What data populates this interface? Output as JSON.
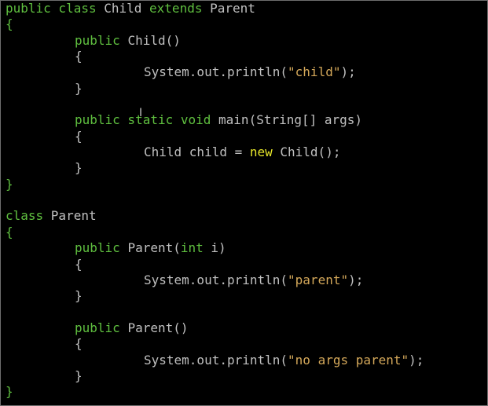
{
  "editor": {
    "lines": [
      {
        "indent": 0,
        "tokens": [
          {
            "t": "public class ",
            "c": "kw"
          },
          {
            "t": "Child ",
            "c": "id"
          },
          {
            "t": "extends ",
            "c": "kw"
          },
          {
            "t": "Parent",
            "c": "id"
          }
        ]
      },
      {
        "indent": 0,
        "tokens": [
          {
            "t": "{",
            "c": "brace"
          }
        ]
      },
      {
        "indent": 1,
        "tokens": [
          {
            "t": "public ",
            "c": "kw"
          },
          {
            "t": "Child()",
            "c": "id"
          }
        ]
      },
      {
        "indent": 1,
        "tokens": [
          {
            "t": "{",
            "c": "id"
          }
        ]
      },
      {
        "indent": 2,
        "tokens": [
          {
            "t": "System.out.println(",
            "c": "id"
          },
          {
            "t": "\"child\"",
            "c": "str"
          },
          {
            "t": ");",
            "c": "id"
          }
        ]
      },
      {
        "indent": 1,
        "tokens": [
          {
            "t": "}",
            "c": "id"
          }
        ]
      },
      {
        "indent": 0,
        "tokens": []
      },
      {
        "indent": 1,
        "tokens": [
          {
            "t": "public static void ",
            "c": "kw"
          },
          {
            "t": "main(String[] args)",
            "c": "id"
          }
        ]
      },
      {
        "indent": 1,
        "tokens": [
          {
            "t": "{",
            "c": "id"
          }
        ]
      },
      {
        "indent": 2,
        "tokens": [
          {
            "t": "Child child = ",
            "c": "id"
          },
          {
            "t": "new ",
            "c": "nw"
          },
          {
            "t": "Child();",
            "c": "id"
          }
        ]
      },
      {
        "indent": 1,
        "tokens": [
          {
            "t": "}",
            "c": "id"
          }
        ]
      },
      {
        "indent": 0,
        "tokens": [
          {
            "t": "}",
            "c": "brace"
          }
        ]
      },
      {
        "indent": 0,
        "tokens": []
      },
      {
        "indent": 0,
        "tokens": [
          {
            "t": "class ",
            "c": "kw"
          },
          {
            "t": "Parent",
            "c": "id"
          }
        ]
      },
      {
        "indent": 0,
        "tokens": [
          {
            "t": "{",
            "c": "brace"
          }
        ]
      },
      {
        "indent": 1,
        "tokens": [
          {
            "t": "public ",
            "c": "kw"
          },
          {
            "t": "Parent(",
            "c": "id"
          },
          {
            "t": "int ",
            "c": "kw"
          },
          {
            "t": "i)",
            "c": "id"
          }
        ]
      },
      {
        "indent": 1,
        "tokens": [
          {
            "t": "{",
            "c": "id"
          }
        ]
      },
      {
        "indent": 2,
        "tokens": [
          {
            "t": "System.out.println(",
            "c": "id"
          },
          {
            "t": "\"parent\"",
            "c": "str"
          },
          {
            "t": ");",
            "c": "id"
          }
        ]
      },
      {
        "indent": 1,
        "tokens": [
          {
            "t": "}",
            "c": "id"
          }
        ]
      },
      {
        "indent": 0,
        "tokens": []
      },
      {
        "indent": 1,
        "tokens": [
          {
            "t": "public ",
            "c": "kw"
          },
          {
            "t": "Parent()",
            "c": "id"
          }
        ]
      },
      {
        "indent": 1,
        "tokens": [
          {
            "t": "{",
            "c": "id"
          }
        ]
      },
      {
        "indent": 2,
        "tokens": [
          {
            "t": "System.out.println(",
            "c": "id"
          },
          {
            "t": "\"no args parent\"",
            "c": "str"
          },
          {
            "t": ");",
            "c": "id"
          }
        ]
      },
      {
        "indent": 1,
        "tokens": [
          {
            "t": "}",
            "c": "id"
          }
        ]
      },
      {
        "indent": 0,
        "tokens": [
          {
            "t": "}",
            "c": "brace"
          }
        ]
      }
    ]
  },
  "colors": {
    "background": "#000000",
    "keyword": "#5fbf3f",
    "new_keyword": "#e8e82a",
    "string": "#d4a85a",
    "text": "#c0c0c0"
  },
  "cursor": {
    "icon": "text-cursor-icon",
    "glyph": "I"
  }
}
